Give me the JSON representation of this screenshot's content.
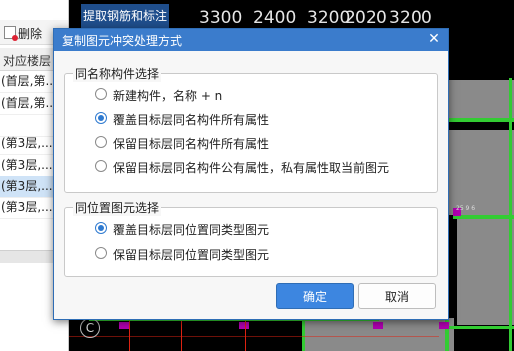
{
  "left_panel": {
    "delete_label": "删除",
    "column_header": "对应楼层",
    "rows": [
      {
        "text": "(首层,第...",
        "selected": false
      },
      {
        "text": "(首层,第...",
        "selected": false
      },
      {
        "text": "",
        "selected": false
      },
      {
        "text": "(第3层,...",
        "selected": false
      },
      {
        "text": "(第3层,...",
        "selected": false
      },
      {
        "text": "(第3层,...",
        "selected": true
      },
      {
        "text": "(第3层,...",
        "selected": false
      }
    ]
  },
  "canvas": {
    "tab_label": "提取钢筋和标注",
    "dimensions": [
      "3300",
      "2400",
      "3200",
      "2",
      "0",
      "2",
      "0",
      "3",
      "2",
      "0",
      "0"
    ],
    "small_label": "25 9 6",
    "axis_label": "C",
    "colors": {
      "background": "#000000",
      "beam": "#33cc33",
      "column": "#b000b0",
      "slab": "#8a8a8a"
    }
  },
  "dialog": {
    "title": "复制图元冲突处理方式",
    "close_icon": "close-icon",
    "group1": {
      "title": "同名称构件选择",
      "options": [
        {
          "label": "新建构件，名称 + n",
          "checked": false
        },
        {
          "label": "覆盖目标层同名构件所有属性",
          "checked": true
        },
        {
          "label": "保留目标层同名构件所有属性",
          "checked": false
        },
        {
          "label": "保留目标层同名构件公有属性，私有属性取当前图元",
          "checked": false
        }
      ]
    },
    "group2": {
      "title": "同位置图元选择",
      "options": [
        {
          "label": "覆盖目标层同位置同类型图元",
          "checked": true
        },
        {
          "label": "保留目标层同位置同类型图元",
          "checked": false
        }
      ]
    },
    "ok_label": "确定",
    "cancel_label": "取消",
    "accent_color": "#3b7ccc"
  }
}
